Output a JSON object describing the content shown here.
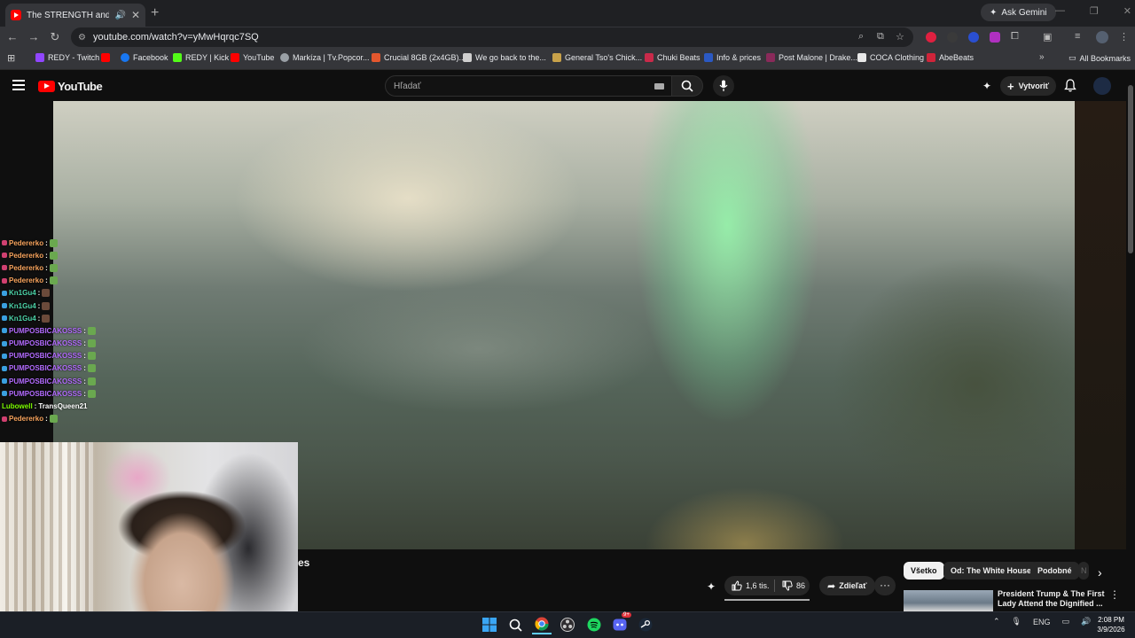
{
  "browser": {
    "tab_title": "The STRENGTH and MIGHT",
    "new_tab_symbol": "+",
    "ask_gemini": "Ask Gemini",
    "url": "youtube.com/watch?v=yMwHqrqc7SQ"
  },
  "bookmarks": [
    {
      "label": "REDY - Twitch",
      "color": "#9146ff"
    },
    {
      "label": "",
      "color": "#ff0000"
    },
    {
      "label": "Facebook",
      "color": "#1877f2"
    },
    {
      "label": "REDY | Kick",
      "color": "#53fc18"
    },
    {
      "label": "YouTube",
      "color": "#ff0000"
    },
    {
      "label": "Markíza | Tv.Popcor...",
      "color": "#9aa0a6"
    },
    {
      "label": "Crucial 8GB (2x4GB)...",
      "color": "#e4572e"
    },
    {
      "label": "We go back to the...",
      "color": "#cfcfcf"
    },
    {
      "label": "General Tso's Chick...",
      "color": "#c8a24a"
    },
    {
      "label": "Chuki Beats",
      "color": "#c92a4a"
    },
    {
      "label": "Info & prices",
      "color": "#2b59c3"
    },
    {
      "label": "Post Malone | Drake...",
      "color": "#8a2a5a"
    },
    {
      "label": "COCA Clothing",
      "color": "#e8e8e8"
    },
    {
      "label": "AbeBeats",
      "color": "#d0243a"
    }
  ],
  "all_bookmarks": "All Bookmarks",
  "youtube": {
    "logo_text": "YouTube",
    "search_placeholder": "Hľadať",
    "create_label": "Vytvoriť",
    "title_fragment": "es",
    "like_count": "1,6 tis.",
    "dislike_count": "86",
    "share_label": "Zdieľať",
    "chips": [
      "Všetko",
      "Od: The White House",
      "Podobné",
      "N"
    ],
    "recommended": {
      "title": "President Trump & The First Lady Attend the Dignified ..."
    }
  },
  "chat": [
    {
      "user": "Pedererko",
      "color": "#f7a35c",
      "msg": "",
      "badge": "#d04070",
      "emote": "#6aa84f"
    },
    {
      "user": "Pedererko",
      "color": "#f7a35c",
      "msg": "",
      "badge": "#d04070",
      "emote": "#6aa84f"
    },
    {
      "user": "Pedererko",
      "color": "#f7a35c",
      "msg": "",
      "badge": "#d04070",
      "emote": "#6aa84f"
    },
    {
      "user": "Pedererko",
      "color": "#f7a35c",
      "msg": "",
      "badge": "#d04070",
      "emote": "#6aa84f"
    },
    {
      "user": "Kn1Gu4",
      "color": "#4cd3a8",
      "msg": "",
      "badge": "#3aa0e0",
      "emote": "#6b4a3a"
    },
    {
      "user": "Kn1Gu4",
      "color": "#4cd3a8",
      "msg": "",
      "badge": "#3aa0e0",
      "emote": "#6b4a3a"
    },
    {
      "user": "Kn1Gu4",
      "color": "#4cd3a8",
      "msg": "",
      "badge": "#3aa0e0",
      "emote": "#6b4a3a"
    },
    {
      "user": "PUMPOSBICAKOSSS",
      "color": "#b36bff",
      "msg": "",
      "badge": "#3aa0e0",
      "emote": "#6aa84f"
    },
    {
      "user": "PUMPOSBICAKOSSS",
      "color": "#b36bff",
      "msg": "",
      "badge": "#3aa0e0",
      "emote": "#6aa84f"
    },
    {
      "user": "PUMPOSBICAKOSSS",
      "color": "#b36bff",
      "msg": "",
      "badge": "#3aa0e0",
      "emote": "#6aa84f"
    },
    {
      "user": "PUMPOSBICAKOSSS",
      "color": "#b36bff",
      "msg": "",
      "badge": "#3aa0e0",
      "emote": "#6aa84f"
    },
    {
      "user": "PUMPOSBICAKOSSS",
      "color": "#b36bff",
      "msg": "",
      "badge": "#3aa0e0",
      "emote": "#6aa84f"
    },
    {
      "user": "PUMPOSBICAKOSSS",
      "color": "#b36bff",
      "msg": "",
      "badge": "#3aa0e0",
      "emote": "#6aa84f"
    },
    {
      "user": "Lubowell",
      "color": "#7cfc00",
      "msg": "TransQueen21",
      "badge": "",
      "emote": ""
    },
    {
      "user": "Pedererko",
      "color": "#f7a35c",
      "msg": "",
      "badge": "#d04070",
      "emote": "#6aa84f"
    }
  ],
  "taskbar": {
    "language": "ENG",
    "time": "2:08 PM",
    "date": "3/9/2026",
    "discord_badge": "9+"
  }
}
